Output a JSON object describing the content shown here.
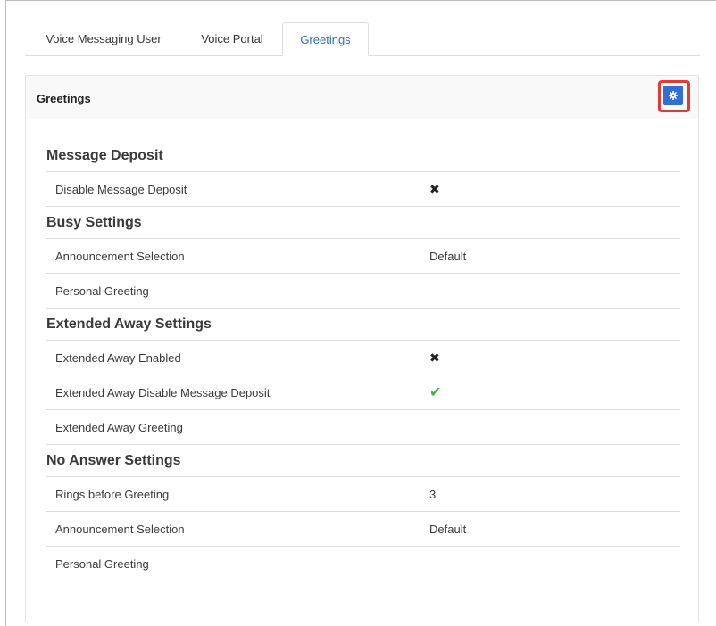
{
  "tabs": [
    {
      "label": "Voice Messaging User",
      "active": false
    },
    {
      "label": "Voice Portal",
      "active": false
    },
    {
      "label": "Greetings",
      "active": true
    }
  ],
  "panel": {
    "title": "Greetings",
    "settings_icon": "gear-icon",
    "highlight_color": "#e53935",
    "button_color": "#2f6fd6"
  },
  "sections": [
    {
      "title": "Message Deposit",
      "rows": [
        {
          "label": "Disable Message Deposit",
          "value": "",
          "icon": "x-icon"
        }
      ]
    },
    {
      "title": "Busy Settings",
      "rows": [
        {
          "label": "Announcement Selection",
          "value": "Default",
          "icon": ""
        },
        {
          "label": "Personal Greeting",
          "value": "",
          "icon": ""
        }
      ]
    },
    {
      "title": "Extended Away Settings",
      "rows": [
        {
          "label": "Extended Away Enabled",
          "value": "",
          "icon": "x-icon"
        },
        {
          "label": "Extended Away Disable Message Deposit",
          "value": "",
          "icon": "check-icon"
        },
        {
          "label": "Extended Away Greeting",
          "value": "",
          "icon": ""
        }
      ]
    },
    {
      "title": "No Answer Settings",
      "rows": [
        {
          "label": "Rings before Greeting",
          "value": "3",
          "icon": ""
        },
        {
          "label": "Announcement Selection",
          "value": "Default",
          "icon": ""
        },
        {
          "label": "Personal Greeting",
          "value": "",
          "icon": ""
        }
      ]
    }
  ]
}
